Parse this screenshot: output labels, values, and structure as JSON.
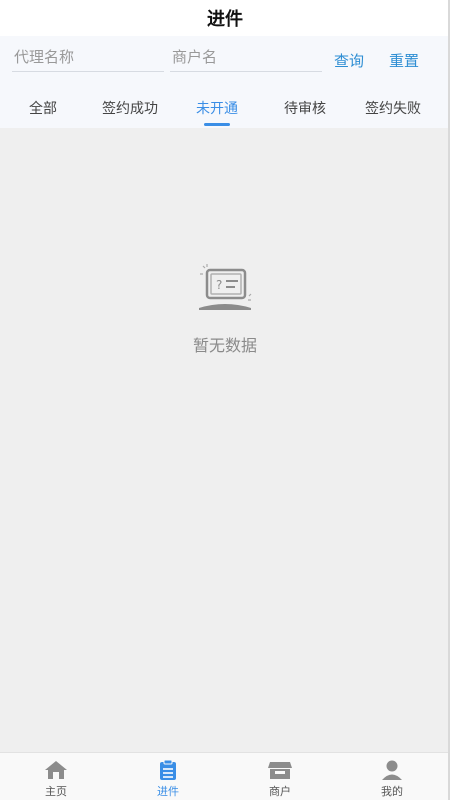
{
  "header": {
    "title": "进件"
  },
  "filter": {
    "agent_placeholder": "代理名称",
    "merchant_placeholder": "商户名",
    "query_label": "查询",
    "reset_label": "重置"
  },
  "tabs": [
    {
      "label": "全部",
      "active": false
    },
    {
      "label": "签约成功",
      "active": false
    },
    {
      "label": "未开通",
      "active": true
    },
    {
      "label": "待审核",
      "active": false
    },
    {
      "label": "签约失败",
      "active": false
    }
  ],
  "empty": {
    "text": "暂无数据",
    "icon": "no-data-icon"
  },
  "bottom_nav": [
    {
      "label": "主页",
      "icon": "home-icon",
      "active": false
    },
    {
      "label": "进件",
      "icon": "clipboard-icon",
      "active": true
    },
    {
      "label": "商户",
      "icon": "store-icon",
      "active": false
    },
    {
      "label": "我的",
      "icon": "user-icon",
      "active": false
    }
  ],
  "colors": {
    "accent": "#3a8ee6",
    "link": "#2e8ed3",
    "background": "#efefef",
    "filter_background": "#f6f8fc"
  }
}
